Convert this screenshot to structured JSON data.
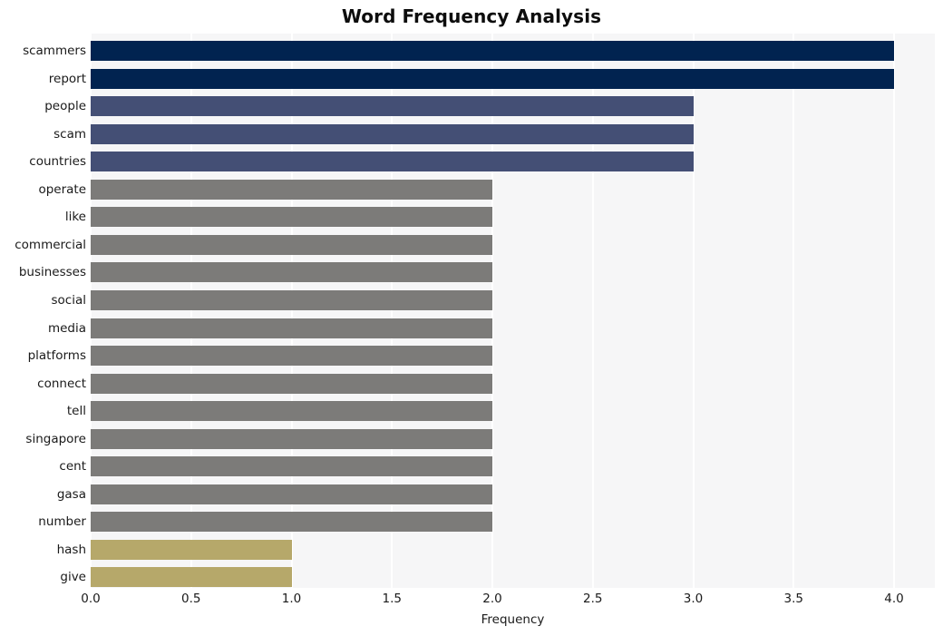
{
  "chart_data": {
    "type": "bar",
    "orientation": "horizontal",
    "title": "Word Frequency Analysis",
    "xlabel": "Frequency",
    "ylabel": "",
    "xlim": [
      0.0,
      4.0
    ],
    "xticks": [
      "0.0",
      "0.5",
      "1.0",
      "1.5",
      "2.0",
      "2.5",
      "3.0",
      "3.5",
      "4.0"
    ],
    "xtick_values": [
      0.0,
      0.5,
      1.0,
      1.5,
      2.0,
      2.5,
      3.0,
      3.5,
      4.0
    ],
    "grid": true,
    "grid_axis": "x",
    "legend": false,
    "categories": [
      "scammers",
      "report",
      "people",
      "scam",
      "countries",
      "operate",
      "like",
      "commercial",
      "businesses",
      "social",
      "media",
      "platforms",
      "connect",
      "tell",
      "singapore",
      "cent",
      "gasa",
      "number",
      "hash",
      "give"
    ],
    "values": [
      4,
      4,
      3,
      3,
      3,
      2,
      2,
      2,
      2,
      2,
      2,
      2,
      2,
      2,
      2,
      2,
      2,
      2,
      1,
      1
    ],
    "bar_colors": [
      "#012350",
      "#012350",
      "#444f75",
      "#444f75",
      "#444f75",
      "#7c7b79",
      "#7c7b79",
      "#7c7b79",
      "#7c7b79",
      "#7c7b79",
      "#7c7b79",
      "#7c7b79",
      "#7c7b79",
      "#7c7b79",
      "#7c7b79",
      "#7c7b79",
      "#7c7b79",
      "#7c7b79",
      "#b6a86a",
      "#b6a86a"
    ]
  },
  "style": {
    "plot_background": "#f6f6f7",
    "figure_background": "#ffffff",
    "grid_color": "#ffffff",
    "text_color": "#1a1a1a",
    "title_color": "#0d0d0d"
  }
}
